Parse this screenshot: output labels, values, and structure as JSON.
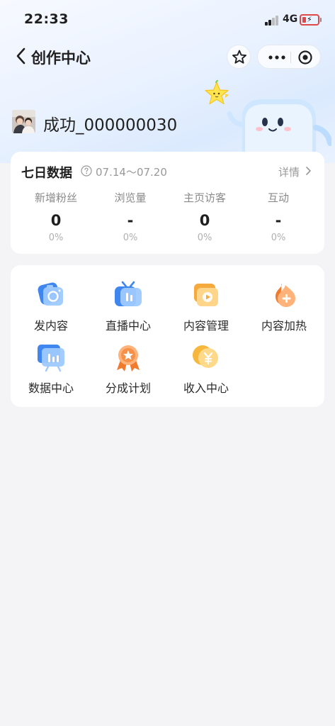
{
  "status_bar": {
    "time": "22:33",
    "network": "4G"
  },
  "nav": {
    "title": "创作中心"
  },
  "profile": {
    "username": "成功_000000030"
  },
  "stats": {
    "title": "七日数据",
    "date_range": "07.14～07.20",
    "detail_label": "详情",
    "items": [
      {
        "label": "新增粉丝",
        "value": "0",
        "change": "0%"
      },
      {
        "label": "浏览量",
        "value": "-",
        "change": "0%"
      },
      {
        "label": "主页访客",
        "value": "0",
        "change": "0%"
      },
      {
        "label": "互动",
        "value": "-",
        "change": "0%"
      }
    ]
  },
  "tools": [
    {
      "label": "发内容",
      "icon": "camera-icon"
    },
    {
      "label": "直播中心",
      "icon": "live-tv-icon"
    },
    {
      "label": "内容管理",
      "icon": "video-folder-icon"
    },
    {
      "label": "内容加热",
      "icon": "flame-plus-icon"
    },
    {
      "label": "数据中心",
      "icon": "chart-board-icon"
    },
    {
      "label": "分成计划",
      "icon": "medal-icon"
    },
    {
      "label": "收入中心",
      "icon": "yuan-coin-icon"
    }
  ],
  "colors": {
    "accent_blue": "#4a90f0",
    "orange": "#f5a23a",
    "coin_gold": "#f6c04a",
    "battery_low": "#e04848"
  }
}
